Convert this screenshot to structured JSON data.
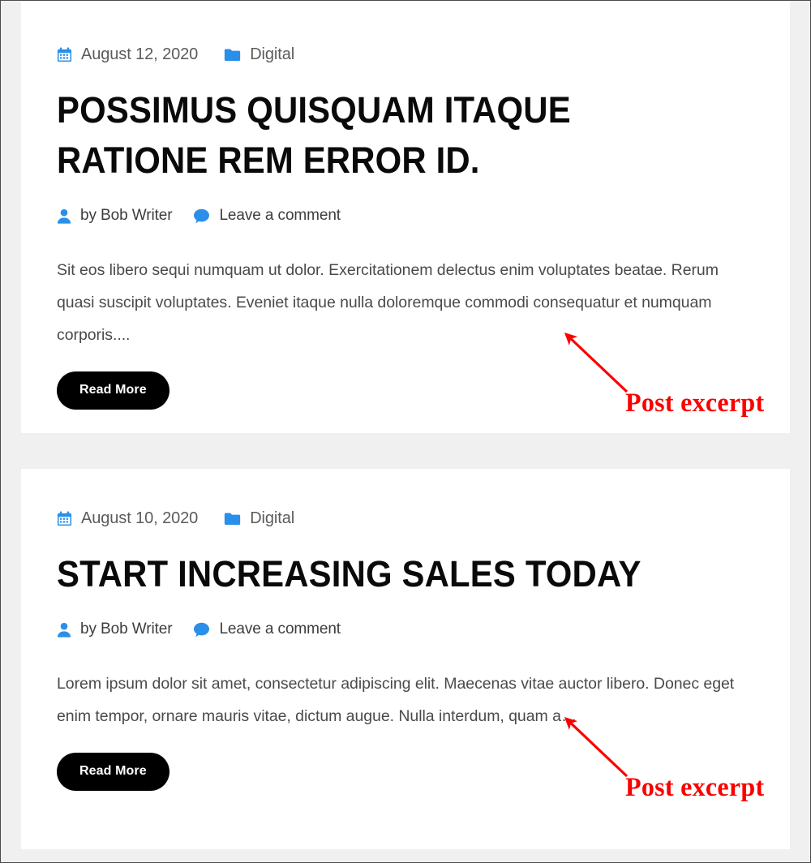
{
  "page": {
    "background_color": "#f0f0f0",
    "card_background": "#ffffff",
    "accent_color": "#2a8fe8",
    "meta_text_color": "#5b5b5b",
    "body_text_color": "#4a4a4a",
    "title_color": "#0a0a0a",
    "annotation_color": "#fc0000",
    "button_background": "#000000",
    "button_text_color": "#ffffff"
  },
  "posts": [
    {
      "date": "August 12, 2020",
      "date_icon": "calendar-icon",
      "category": "Digital",
      "category_icon": "folder-icon",
      "title": "Possimus quisquam itaque ratione rem error id.",
      "author": "by Bob Writer",
      "author_icon": "user-icon",
      "comment_link": "Leave a comment",
      "comment_icon": "comment-bubble-icon",
      "excerpt": "Sit eos libero sequi numquam ut dolor. Exercitationem delectus enim voluptates beatae. Rerum quasi suscipit voluptates. Eveniet itaque nulla doloremque commodi consequatur et numquam corporis....",
      "read_more": "Read More"
    },
    {
      "date": "August 10, 2020",
      "date_icon": "calendar-icon",
      "category": "Digital",
      "category_icon": "folder-icon",
      "title": "Start increasing sales today",
      "author": "by Bob Writer",
      "author_icon": "user-icon",
      "comment_link": "Leave a comment",
      "comment_icon": "comment-bubble-icon",
      "excerpt": "Lorem ipsum dolor sit amet, consectetur adipiscing elit. Maecenas vitae auctor libero. Donec eget enim tempor, ornare mauris vitae, dictum augue. Nulla interdum, quam a…",
      "read_more": "Read More"
    }
  ],
  "annotations": [
    {
      "label": "Post excerpt"
    },
    {
      "label": "Post excerpt"
    }
  ]
}
